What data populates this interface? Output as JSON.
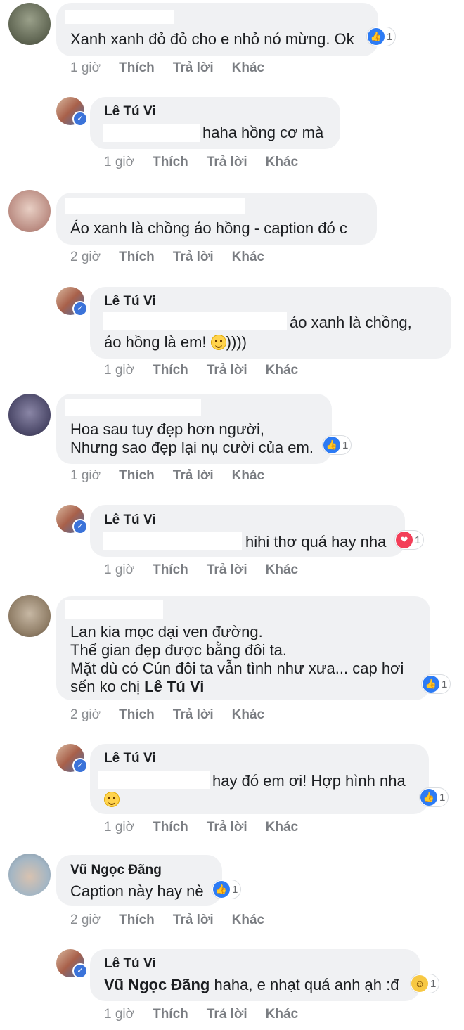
{
  "actions": {
    "like": "Thích",
    "reply": "Trả lời",
    "more": "Khác"
  },
  "comments": [
    {
      "author": "",
      "text": [
        "Xanh xanh đỏ đỏ cho e nhỏ nó mừng. Ok"
      ],
      "time": "1 giờ",
      "reaction": {
        "type": "like",
        "count": "1"
      },
      "reply": {
        "author": "Lê Tú Vi",
        "text": [
          "haha hồng cơ mà"
        ],
        "time": "1 giờ"
      }
    },
    {
      "author": "",
      "text": [
        "Áo xanh là chồng áo hồng - caption đó c"
      ],
      "time": "2 giờ",
      "reply": {
        "author": "Lê Tú Vi",
        "text": [
          "áo xanh là chồng,",
          "áo hồng là em!",
          "))))"
        ],
        "time": "1 giờ"
      }
    },
    {
      "author": "",
      "text": [
        "Hoa sau tuy đẹp hơn người,",
        "Nhưng sao đẹp lại nụ cười của em."
      ],
      "time": "1 giờ",
      "reaction": {
        "type": "like",
        "count": "1"
      },
      "reply": {
        "author": "Lê Tú Vi",
        "text": [
          "hihi thơ quá hay nha"
        ],
        "time": "1 giờ",
        "reaction": {
          "type": "love",
          "count": "1"
        }
      }
    },
    {
      "author": "",
      "text": [
        "Lan kia mọc dại ven đường.",
        "Thế gian đẹp được bằng đôi ta.",
        "Mặt dù có Cún đôi ta vẫn tình như xưa... cap hơi",
        "sến ko chị ",
        "Lê Tú Vi"
      ],
      "time": "2 giờ",
      "reaction": {
        "type": "like",
        "count": "1"
      },
      "reply": {
        "author": "Lê Tú Vi",
        "text": [
          "hay đó em ơi! Hợp hình nha"
        ],
        "time": "1 giờ",
        "reaction": {
          "type": "like",
          "count": "1"
        }
      }
    },
    {
      "author": "Vũ Ngọc Đãng",
      "text": [
        "Caption này hay nè"
      ],
      "time": "2 giờ",
      "reaction": {
        "type": "like",
        "count": "1"
      },
      "reply": {
        "author": "Lê Tú Vi",
        "text": [
          "Vũ Ngọc Đãng",
          " haha, e nhạt quá anh ạh :đ"
        ],
        "time": "1 giờ",
        "reaction": {
          "type": "haha",
          "count": "1"
        }
      }
    }
  ],
  "colors": {
    "bubble": "#f0f1f3",
    "like": "#2d7bf4",
    "love": "#f33e58",
    "haha": "#f7c843",
    "verified": "#3b73d9"
  },
  "icons": {
    "like": "thumbs-up-icon",
    "love": "heart-icon",
    "haha": "laughing-face-icon",
    "verified": "verified-check-icon",
    "smile": "smile-emoji-icon"
  }
}
